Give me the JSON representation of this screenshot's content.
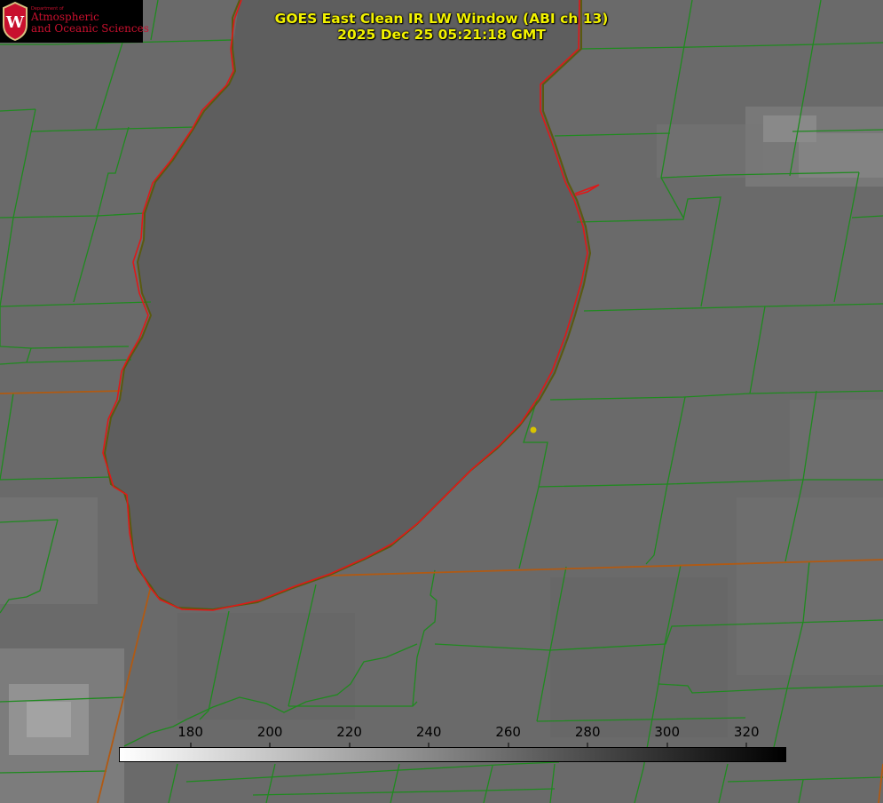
{
  "header": {
    "title_line1": "GOES East Clean IR LW Window (ABI ch 13)",
    "title_line2": "2025 Dec 25 05:21:18 GMT"
  },
  "logo": {
    "department": "Department of",
    "line1": "Atmospheric",
    "line2": "and Oceanic Sciences",
    "seal_letter": "W"
  },
  "colorbar": {
    "min": 162,
    "max": 330,
    "ticks": [
      {
        "label": "180",
        "value": 180
      },
      {
        "label": "200",
        "value": 200
      },
      {
        "label": "220",
        "value": 220
      },
      {
        "label": "240",
        "value": 240
      },
      {
        "label": "260",
        "value": 260
      },
      {
        "label": "280",
        "value": 280
      },
      {
        "label": "300",
        "value": 300
      },
      {
        "label": "320",
        "value": 320
      }
    ],
    "color_low": "#ffffff",
    "color_high": "#000000"
  },
  "colors": {
    "county_lines": "#1f8a1f",
    "state_lines": "#b05a14",
    "lake_outline_red": "#e01818",
    "lake_fill": "#626262",
    "land_fill": "#6c6c6c",
    "marker": "#d8c400",
    "title_text": "#f2f200"
  },
  "icons": {
    "logo": "uw-seal-icon",
    "marker": "station-dot-icon"
  }
}
